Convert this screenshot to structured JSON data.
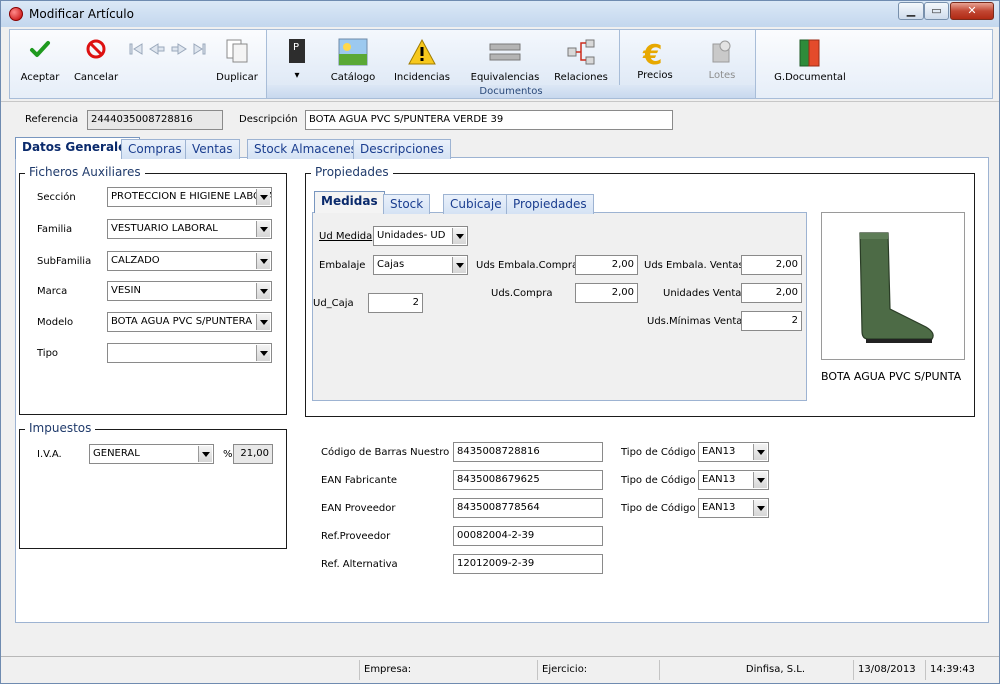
{
  "window": {
    "title": "Modificar Artículo",
    "min": "▁",
    "max": "▭",
    "close": "✕"
  },
  "toolbar": {
    "aceptar": "Aceptar",
    "cancelar": "Cancelar",
    "duplicar": "Duplicar",
    "catalogo": "Catálogo",
    "incidencias": "Incidencias",
    "equivalencias": "Equivalencias",
    "relaciones": "Relaciones",
    "precios": "Precios",
    "lotes": "Lotes",
    "gdocumental": "G.Documental",
    "documentos_caption": "Documentos",
    "p_label": "P",
    "p_dropdown": "▾"
  },
  "header": {
    "referencia_label": "Referencia",
    "referencia_value": "2444035008728816",
    "descripcion_label": "Descripción",
    "descripcion_value": "BOTA AGUA PVC S/PUNTERA VERDE 39"
  },
  "tabs": [
    "Datos Generales",
    "Compras",
    "Ventas",
    "Stock Almacenes",
    "Descripciones"
  ],
  "ficheros": {
    "title": "Ficheros Auxiliares",
    "seccion_label": "Sección",
    "seccion_value": "PROTECCION E HIGIENE LABORAL",
    "familia_label": "Familia",
    "familia_value": "VESTUARIO LABORAL",
    "subfamilia_label": "SubFamilia",
    "subfamilia_value": "CALZADO",
    "marca_label": "Marca",
    "marca_value": "VESIN",
    "modelo_label": "Modelo",
    "modelo_value": "BOTA AGUA PVC S/PUNTERA",
    "tipo_label": "Tipo",
    "tipo_value": ""
  },
  "impuestos": {
    "title": "Impuestos",
    "iva_label": "I.V.A.",
    "iva_value": "GENERAL",
    "pct_label": "%",
    "pct_value": "21,00"
  },
  "propiedades": {
    "title": "Propiedades",
    "subtabs": [
      "Medidas",
      "Stock",
      "Cubicaje",
      "Propiedades"
    ],
    "ud_medida_label": "Ud Medida",
    "ud_medida_value": "Unidades- UD",
    "embalaje_label": "Embalaje",
    "embalaje_value": "Cajas",
    "ud_caja_label": "Ud_Caja",
    "ud_caja_value": "2",
    "uds_embala_compras_label": "Uds Embala.Compras",
    "uds_embala_compras_value": "2,00",
    "uds_compra_label": "Uds.Compra",
    "uds_compra_value": "2,00",
    "uds_embala_ventas_label": "Uds Embala. Ventas",
    "uds_embala_ventas_value": "2,00",
    "unidades_venta_label": "Unidades Venta",
    "unidades_venta_value": "2,00",
    "uds_minimas_venta_label": "Uds.Mínimas Venta",
    "uds_minimas_venta_value": "2",
    "photo_caption": "BOTA AGUA PVC S/PUNTA"
  },
  "codigos": {
    "barras_label": "Código de Barras Nuestro",
    "barras_value": "8435008728816",
    "ean_fab_label": "EAN Fabricante",
    "ean_fab_value": "8435008679625",
    "ean_prov_label": "EAN Proveedor",
    "ean_prov_value": "8435008778564",
    "ref_prov_label": "Ref.Proveedor",
    "ref_prov_value": "00082004-2-39",
    "ref_alt_label": "Ref. Alternativa",
    "ref_alt_value": "12012009-2-39",
    "tipo_label": "Tipo de Código",
    "tipo1_value": "EAN13",
    "tipo2_value": "EAN13",
    "tipo3_value": "EAN13"
  },
  "status": {
    "empresa_label": "Empresa:",
    "ejercicio_label": "Ejercicio:",
    "company": "Dinfisa, S.L.",
    "date": "13/08/2013",
    "time": "14:39:43"
  }
}
